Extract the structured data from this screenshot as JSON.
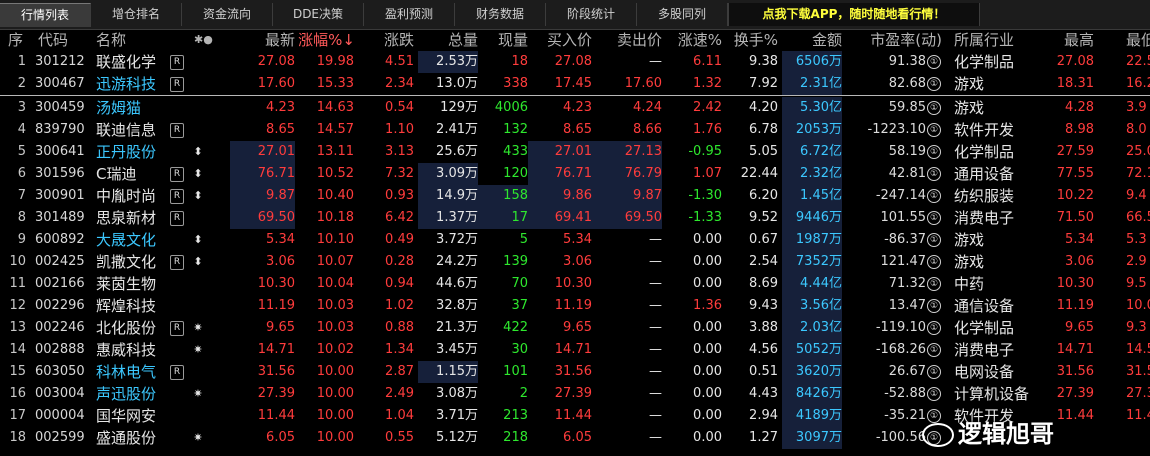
{
  "tabs": [
    {
      "label": "行情列表",
      "active": true
    },
    {
      "label": "增仓排名",
      "active": false
    },
    {
      "label": "资金流向",
      "active": false
    },
    {
      "label": "DDE决策",
      "active": false
    },
    {
      "label": "盈利预测",
      "active": false
    },
    {
      "label": "财务数据",
      "active": false
    },
    {
      "label": "阶段统计",
      "active": false
    },
    {
      "label": "多股同列",
      "active": false
    }
  ],
  "promo": "点我下载APP，随时随地看行情！",
  "columns": [
    "序",
    "代码",
    "名称",
    "✱●",
    "最新",
    "涨幅%↓",
    "涨跌",
    "总量",
    "现量",
    "买入价",
    "卖出价",
    "涨速%",
    "换手%",
    "金额",
    "市盈率(动)",
    "所属行业",
    "最高",
    "最低"
  ],
  "rows": [
    {
      "idx": "1",
      "code": "301212",
      "name": "联盛化学",
      "r": "R",
      "mk": "",
      "last": "27.08",
      "chg": "19.98",
      "diff": "4.51",
      "vol": "2.53万",
      "cur": "18",
      "bid": "27.08",
      "ask": "—",
      "spd": "6.11",
      "turn": "9.38",
      "amt": "6506万",
      "pe": "91.38",
      "pe_mark": "①",
      "ind": "化学制品",
      "high": "27.08",
      "low": "22.5"
    },
    {
      "idx": "2",
      "code": "300467",
      "name": "迅游科技",
      "r": "R",
      "mk": "",
      "last": "17.60",
      "chg": "15.33",
      "diff": "2.34",
      "vol": "13.0万",
      "cur": "338",
      "bid": "17.45",
      "ask": "17.60",
      "spd": "1.32",
      "turn": "7.92",
      "amt": "2.31亿",
      "pe": "82.68",
      "pe_mark": "①",
      "ind": "游戏",
      "high": "18.31",
      "low": "16.2"
    },
    {
      "idx": "3",
      "code": "300459",
      "name": "汤姆猫",
      "r": "",
      "mk": "",
      "last": "4.23",
      "chg": "14.63",
      "diff": "0.54",
      "vol": "129万",
      "cur": "4006",
      "bid": "4.23",
      "ask": "4.24",
      "spd": "2.42",
      "turn": "4.20",
      "amt": "5.30亿",
      "pe": "59.85",
      "pe_mark": "①",
      "ind": "游戏",
      "high": "4.28",
      "low": "3.9"
    },
    {
      "idx": "4",
      "code": "839790",
      "name": "联迪信息",
      "r": "R",
      "mk": "",
      "last": "8.65",
      "chg": "14.57",
      "diff": "1.10",
      "vol": "2.41万",
      "cur": "132",
      "bid": "8.65",
      "ask": "8.66",
      "spd": "1.76",
      "turn": "6.78",
      "amt": "2053万",
      "pe": "-1223.10",
      "pe_mark": "①",
      "ind": "软件开发",
      "high": "8.98",
      "low": "8.0"
    },
    {
      "idx": "5",
      "code": "300641",
      "name": "正丹股份",
      "r": "",
      "mk": "⬍",
      "last": "27.01",
      "chg": "13.11",
      "diff": "3.13",
      "vol": "25.6万",
      "cur": "433",
      "bid": "27.01",
      "ask": "27.13",
      "spd": "-0.95",
      "turn": "5.05",
      "amt": "6.72亿",
      "pe": "58.19",
      "pe_mark": "①",
      "ind": "化学制品",
      "high": "27.59",
      "low": "25.0"
    },
    {
      "idx": "6",
      "code": "301596",
      "name": "C瑞迪",
      "r": "R",
      "mk": "⬍",
      "last": "76.71",
      "chg": "10.52",
      "diff": "7.32",
      "vol": "3.09万",
      "cur": "120",
      "bid": "76.71",
      "ask": "76.79",
      "spd": "1.07",
      "turn": "22.44",
      "amt": "2.32亿",
      "pe": "42.81",
      "pe_mark": "①",
      "ind": "通用设备",
      "high": "77.55",
      "low": "72.1"
    },
    {
      "idx": "7",
      "code": "300901",
      "name": "中胤时尚",
      "r": "R",
      "mk": "⬍",
      "last": "9.87",
      "chg": "10.40",
      "diff": "0.93",
      "vol": "14.9万",
      "cur": "158",
      "bid": "9.86",
      "ask": "9.87",
      "spd": "-1.30",
      "turn": "6.20",
      "amt": "1.45亿",
      "pe": "-247.14",
      "pe_mark": "①",
      "ind": "纺织服装",
      "high": "10.22",
      "low": "9.4"
    },
    {
      "idx": "8",
      "code": "301489",
      "name": "思泉新材",
      "r": "R",
      "mk": "",
      "last": "69.50",
      "chg": "10.18",
      "diff": "6.42",
      "vol": "1.37万",
      "cur": "17",
      "bid": "69.41",
      "ask": "69.50",
      "spd": "-1.33",
      "turn": "9.52",
      "amt": "9446万",
      "pe": "101.55",
      "pe_mark": "①",
      "ind": "消费电子",
      "high": "71.50",
      "low": "66.5"
    },
    {
      "idx": "9",
      "code": "600892",
      "name": "大晟文化",
      "r": "",
      "mk": "⬍",
      "last": "5.34",
      "chg": "10.10",
      "diff": "0.49",
      "vol": "3.72万",
      "cur": "5",
      "bid": "5.34",
      "ask": "—",
      "spd": "0.00",
      "turn": "0.67",
      "amt": "1987万",
      "pe": "-86.37",
      "pe_mark": "①",
      "ind": "游戏",
      "high": "5.34",
      "low": "5.3"
    },
    {
      "idx": "10",
      "code": "002425",
      "name": "凯撒文化",
      "r": "R",
      "mk": "⬍",
      "last": "3.06",
      "chg": "10.07",
      "diff": "0.28",
      "vol": "24.2万",
      "cur": "139",
      "bid": "3.06",
      "ask": "—",
      "spd": "0.00",
      "turn": "2.54",
      "amt": "7352万",
      "pe": "121.47",
      "pe_mark": "①",
      "ind": "游戏",
      "high": "3.06",
      "low": "2.9"
    },
    {
      "idx": "11",
      "code": "002166",
      "name": "莱茵生物",
      "r": "",
      "mk": "",
      "last": "10.30",
      "chg": "10.04",
      "diff": "0.94",
      "vol": "44.6万",
      "cur": "70",
      "bid": "10.30",
      "ask": "—",
      "spd": "0.00",
      "turn": "8.69",
      "amt": "4.44亿",
      "pe": "71.32",
      "pe_mark": "①",
      "ind": "中药",
      "high": "10.30",
      "low": "9.5"
    },
    {
      "idx": "12",
      "code": "002296",
      "name": "辉煌科技",
      "r": "",
      "mk": "",
      "last": "11.19",
      "chg": "10.03",
      "diff": "1.02",
      "vol": "32.8万",
      "cur": "37",
      "bid": "11.19",
      "ask": "—",
      "spd": "1.36",
      "turn": "9.43",
      "amt": "3.56亿",
      "pe": "13.47",
      "pe_mark": "①",
      "ind": "通信设备",
      "high": "11.19",
      "low": "10.0"
    },
    {
      "idx": "13",
      "code": "002246",
      "name": "北化股份",
      "r": "R",
      "mk": "✷",
      "last": "9.65",
      "chg": "10.03",
      "diff": "0.88",
      "vol": "21.3万",
      "cur": "422",
      "bid": "9.65",
      "ask": "—",
      "spd": "0.00",
      "turn": "3.88",
      "amt": "2.03亿",
      "pe": "-119.10",
      "pe_mark": "①",
      "ind": "化学制品",
      "high": "9.65",
      "low": "9.3"
    },
    {
      "idx": "14",
      "code": "002888",
      "name": "惠威科技",
      "r": "",
      "mk": "✷",
      "last": "14.71",
      "chg": "10.02",
      "diff": "1.34",
      "vol": "3.45万",
      "cur": "30",
      "bid": "14.71",
      "ask": "—",
      "spd": "0.00",
      "turn": "4.56",
      "amt": "5052万",
      "pe": "-168.26",
      "pe_mark": "①",
      "ind": "消费电子",
      "high": "14.71",
      "low": "14.5"
    },
    {
      "idx": "15",
      "code": "603050",
      "name": "科林电气",
      "r": "R",
      "mk": "",
      "last": "31.56",
      "chg": "10.00",
      "diff": "2.87",
      "vol": "1.15万",
      "cur": "101",
      "bid": "31.56",
      "ask": "—",
      "spd": "0.00",
      "turn": "0.51",
      "amt": "3620万",
      "pe": "26.67",
      "pe_mark": "①",
      "ind": "电网设备",
      "high": "31.56",
      "low": "31.5"
    },
    {
      "idx": "16",
      "code": "003004",
      "name": "声迅股份",
      "r": "",
      "mk": "✷",
      "last": "27.39",
      "chg": "10.00",
      "diff": "2.49",
      "vol": "3.08万",
      "cur": "2",
      "bid": "27.39",
      "ask": "—",
      "spd": "0.00",
      "turn": "4.43",
      "amt": "8426万",
      "pe": "-52.88",
      "pe_mark": "①",
      "ind": "计算机设备",
      "high": "27.39",
      "low": "27.3"
    },
    {
      "idx": "17",
      "code": "000004",
      "name": "国华网安",
      "r": "",
      "mk": "",
      "last": "11.44",
      "chg": "10.00",
      "diff": "1.04",
      "vol": "3.71万",
      "cur": "213",
      "bid": "11.44",
      "ask": "—",
      "spd": "0.00",
      "turn": "2.94",
      "amt": "4189万",
      "pe": "-35.21",
      "pe_mark": "①",
      "ind": "软件开发",
      "high": "11.44",
      "low": "11.4"
    },
    {
      "idx": "18",
      "code": "002599",
      "name": "盛通股份",
      "r": "",
      "mk": "✷",
      "last": "6.05",
      "chg": "10.00",
      "diff": "0.55",
      "vol": "5.12万",
      "cur": "218",
      "bid": "6.05",
      "ask": "—",
      "spd": "0.00",
      "turn": "1.27",
      "amt": "3097万",
      "pe": "-100.56",
      "pe_mark": "①",
      "ind": "",
      "high": "",
      "low": ""
    }
  ],
  "watermark": "逻辑旭哥"
}
